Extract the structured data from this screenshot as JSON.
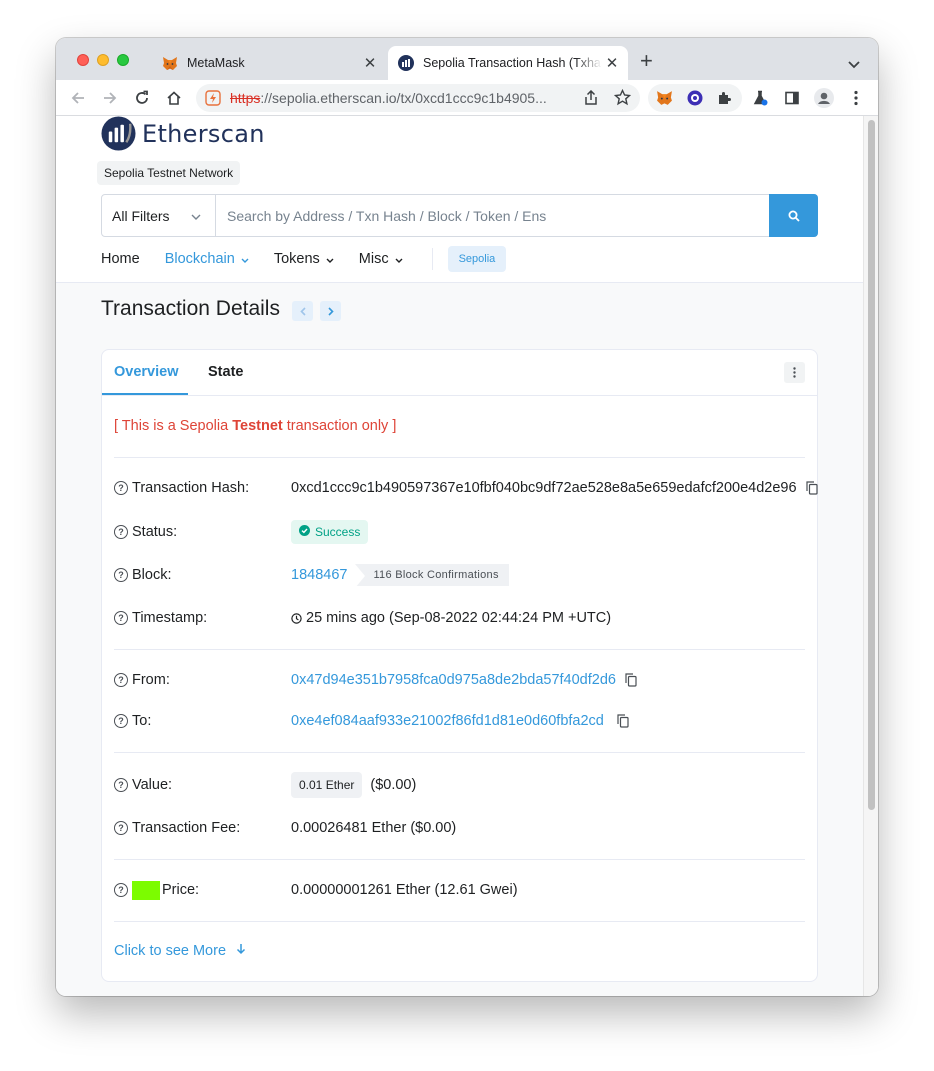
{
  "browser": {
    "tabs": [
      {
        "title": "MetaMask",
        "active": false
      },
      {
        "title": "Sepolia Transaction Hash (Txhash",
        "active": true
      }
    ],
    "url_scheme": "https",
    "url_rest": "://sepolia.etherscan.io/tx/0xcd1ccc9c1b4905..."
  },
  "site": {
    "logo_text": "Etherscan",
    "network_badge": "Sepolia Testnet Network",
    "search": {
      "filter_label": "All Filters",
      "placeholder": "Search by Address / Txn Hash / Block / Token / Ens"
    },
    "nav": [
      {
        "label": "Home"
      },
      {
        "label": "Blockchain"
      },
      {
        "label": "Tokens"
      },
      {
        "label": "Misc"
      }
    ],
    "network_pill": "Sepolia"
  },
  "page": {
    "title": "Transaction Details",
    "tabs": [
      {
        "label": "Overview"
      },
      {
        "label": "State"
      }
    ],
    "notice_prefix": "[ This is a Sepolia ",
    "notice_bold": "Testnet",
    "notice_suffix": " transaction only ]",
    "rows": {
      "hash": {
        "label": "Transaction Hash:",
        "value": "0xcd1ccc9c1b490597367e10fbf040bc9df72ae528e8a5e659edafcf200e4d2e96"
      },
      "status": {
        "label": "Status:",
        "value": "Success"
      },
      "block": {
        "label": "Block:",
        "value": "1848467",
        "confirmations": "116 Block Confirmations"
      },
      "timestamp": {
        "label": "Timestamp:",
        "value": "25 mins ago (Sep-08-2022 02:44:24 PM +UTC)"
      },
      "from": {
        "label": "From:",
        "value": "0x47d94e351b7958fca0d975a8de2bda57f40df2d6"
      },
      "to": {
        "label": "To:",
        "value": "0xe4ef084aaf933e21002f86fd1d81e0d60fbfa2cd"
      },
      "value": {
        "label": "Value:",
        "pill": "0.01 Ether",
        "usd": "($0.00)"
      },
      "fee": {
        "label": "Transaction Fee:",
        "value": "0.00026481 Ether ($0.00)"
      },
      "price": {
        "label": "Price:",
        "value": "0.00000001261 Ether (12.61 Gwei)"
      }
    },
    "more_label": "Click to see More"
  },
  "colors": {
    "accent": "#3498db",
    "notice": "#de4437",
    "success": "#00a186",
    "highlight": "#7cfc00"
  }
}
